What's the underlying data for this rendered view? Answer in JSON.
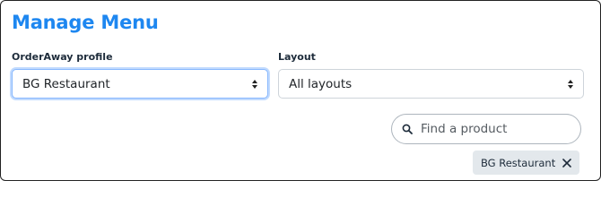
{
  "page": {
    "title": "Manage Menu"
  },
  "profile": {
    "label": "OrderAway profile",
    "selected": "BG Restaurant"
  },
  "layout": {
    "label": "Layout",
    "selected": "All layouts"
  },
  "search": {
    "placeholder": "Find a product",
    "value": ""
  },
  "filters": {
    "chips": [
      {
        "label": "BG Restaurant"
      }
    ]
  },
  "colors": {
    "title": "#1e87f0",
    "chip_bg": "#e3e8ec",
    "focus_border": "#86b7fe"
  },
  "icons": {
    "search": "search-icon",
    "chip_remove": "close-icon",
    "select_caret": "chevron-up-down-icon"
  }
}
